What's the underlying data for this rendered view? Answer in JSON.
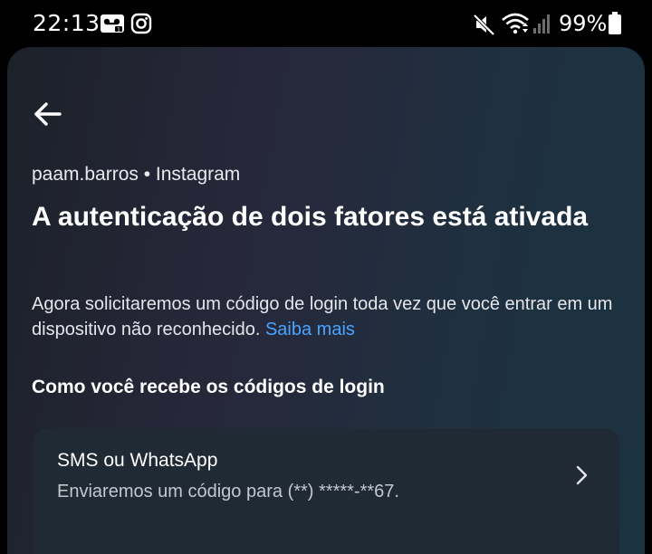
{
  "status_bar": {
    "time": "22:13",
    "battery": "99%",
    "icons": [
      "voicemail-icon",
      "instagram-icon",
      "mute-icon",
      "wifi-icon",
      "signal-icon",
      "battery-icon"
    ]
  },
  "header": {
    "back_icon": "arrow-left-icon",
    "account": "paam.barros • Instagram",
    "title": "A autenticação de dois fatores está ativada"
  },
  "description": {
    "text": "Agora solicitaremos um código de login toda vez que você entrar em um dispositivo não reconhecido. ",
    "link": "Saiba mais"
  },
  "section": {
    "heading": "Como você recebe os códigos de login"
  },
  "method": {
    "title": "SMS ou WhatsApp",
    "detail": "Enviaremos um código para (**) *****-**67."
  },
  "colors": {
    "link": "#4aa3ff",
    "card": "#1f2a35",
    "background": "#000000"
  }
}
